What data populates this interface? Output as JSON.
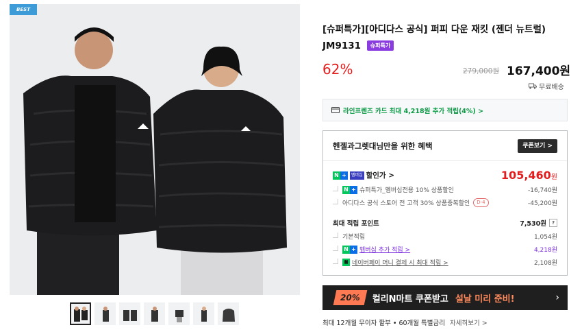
{
  "gallery": {
    "badge": "BEST",
    "thumb_count": 7
  },
  "product": {
    "title": "[슈퍼특가][아디다스 공식] 퍼피 다운 재킷 (젠더 뉴트럴) JM9131",
    "badge": "슈퍼특가",
    "discount_rate": "62%",
    "original_price": "279,000원",
    "sale_price": "167,400원",
    "shipping": "무료배송"
  },
  "card_banner": {
    "text": "라인프렌즈 카드 최대 4,218원 추가 적립(4%) >"
  },
  "benefit": {
    "title": "헨젤과그렛대님만을 위한 혜택",
    "coupon_button": "쿠폰보기 >",
    "member_tag": "멤버십",
    "sale_label": "할인가 >",
    "sale_price": "105,460",
    "sale_price_unit": "원",
    "discounts": [
      {
        "label": "슈퍼특가_멤버십전용 10% 상품할인",
        "value": "-16,740원"
      },
      {
        "label": "아디다스 공식 스토어 전 고객 30% 상품중복할인",
        "dday": "D-4",
        "value": "-45,200원"
      }
    ],
    "points_label": "최대 적립 포인트",
    "points_total": "7,530원",
    "points_help": "?",
    "points": [
      {
        "label": "기본적립",
        "value": "1,054원"
      },
      {
        "label": "멤버십 추가 적립 >",
        "value": "4,218원"
      },
      {
        "label": "네이버페이 머니 결제 시 최대 적립 >",
        "value": "2,108원"
      }
    ]
  },
  "kurly_banner": {
    "pct": "20%",
    "text": "컬리N마트 쿠폰받고",
    "highlight": "설날 미리 준비!",
    "arrow": "›"
  },
  "installment": {
    "text": "최대 12개월 무이자 할부 • 60개월 특별금리",
    "more": "자세히보기 >"
  },
  "colors": {
    "discount": "#e31d1d",
    "naver_green": "#03c75a",
    "purple": "#7b2fe0",
    "badge_blue": "#3d9bd8"
  }
}
